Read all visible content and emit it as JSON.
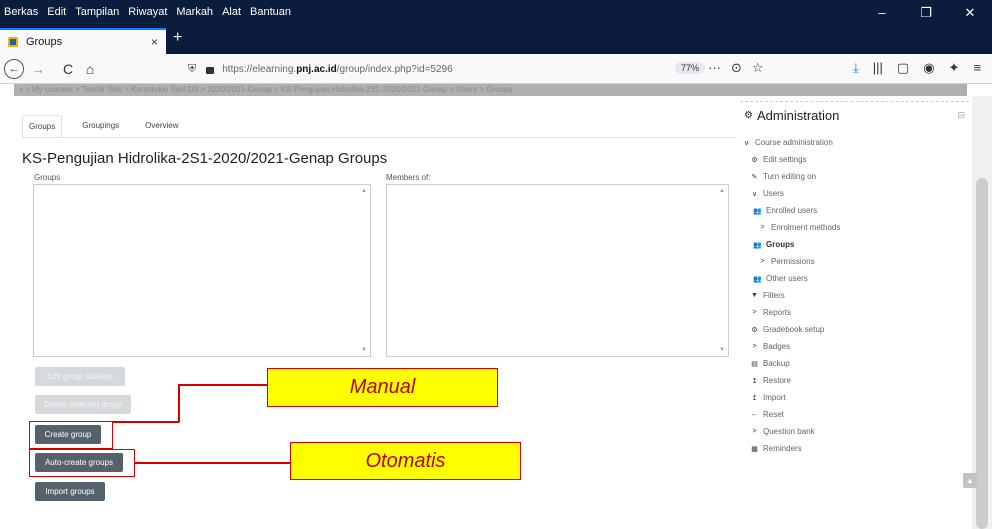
{
  "window": {
    "menu": [
      "Berkas",
      "Edit",
      "Tampilan",
      "Riwayat",
      "Markah",
      "Alat",
      "Bantuan"
    ],
    "minimize": "–",
    "restore": "❐",
    "close": "✕"
  },
  "browser": {
    "tab_title": "Groups",
    "tab_close": "×",
    "new_tab": "+",
    "url_prefix": "https://elearning.",
    "url_domain": "pnj.ac.id",
    "url_path": "/group/index.php?id=5296",
    "zoom": "77%",
    "back": "←",
    "forward": "→",
    "reload": "C",
    "home": "⌂",
    "page_actions": "···",
    "pocket": "⊙",
    "bookmark": "☆",
    "download": "⤓",
    "library": "|||",
    "sidebar": "▢",
    "account": "◉",
    "extensions": "✦",
    "menu": "≡",
    "site_shield": "⛨"
  },
  "breadcrumb": "▪ > My courses > Teknik Sipil > Konstruksi Sipil D3 > 2020/2021-Genap > KS-Pengujian Hidrolika-2S1-2020/2021-Genap > Users > Groups",
  "nav_tabs": [
    "Groups",
    "Groupings",
    "Overview"
  ],
  "page_heading": "KS-Pengujian Hidrolika-2S1-2020/2021-Genap Groups",
  "groups_label": "Groups",
  "members_label": "Members of:",
  "buttons": {
    "edit": "Edit group settings",
    "delete": "Delete selected group",
    "create": "Create group",
    "auto": "Auto-create groups",
    "import": "Import groups"
  },
  "annotations": {
    "manual": "Manual",
    "otomatis": "Otomatis",
    "color": "#d40000",
    "fill": "#ffff00"
  },
  "admin": {
    "title": "Administration",
    "collapse": "⊟",
    "items": [
      {
        "label": "Course administration",
        "icon": "∨",
        "name": "course-administration"
      },
      {
        "label": "Edit settings",
        "icon": "⚙",
        "name": "edit-settings"
      },
      {
        "label": "Turn editing on",
        "icon": "✎",
        "name": "turn-editing-on"
      },
      {
        "label": "Users",
        "icon": "∨",
        "name": "users"
      },
      {
        "label": "Enrolled users",
        "icon": "👥",
        "name": "enrolled-users"
      },
      {
        "label": "Enrolment methods",
        "icon": ">",
        "name": "enrolment-methods"
      },
      {
        "label": "Groups",
        "icon": "👥",
        "name": "groups"
      },
      {
        "label": "Permissions",
        "icon": ">",
        "name": "permissions"
      },
      {
        "label": "Other users",
        "icon": "👥",
        "name": "other-users"
      },
      {
        "label": "Filters",
        "icon": "▼",
        "name": "filters"
      },
      {
        "label": "Reports",
        "icon": ">",
        "name": "reports"
      },
      {
        "label": "Gradebook setup",
        "icon": "⚙",
        "name": "gradebook-setup"
      },
      {
        "label": "Badges",
        "icon": ">",
        "name": "badges"
      },
      {
        "label": "Backup",
        "icon": "▤",
        "name": "backup"
      },
      {
        "label": "Restore",
        "icon": "↥",
        "name": "restore"
      },
      {
        "label": "Import",
        "icon": "↥",
        "name": "import"
      },
      {
        "label": "Reset",
        "icon": "←",
        "name": "reset"
      },
      {
        "label": "Question bank",
        "icon": ">",
        "name": "question-bank"
      },
      {
        "label": "Reminders",
        "icon": "▦",
        "name": "reminders"
      }
    ]
  },
  "scroll_top": "▲"
}
